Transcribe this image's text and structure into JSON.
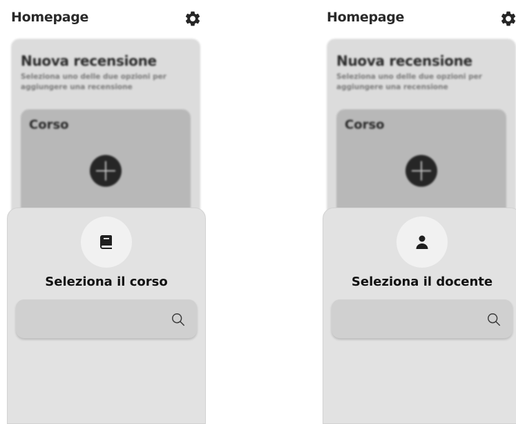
{
  "screens": [
    {
      "header": {
        "title": "Homepage",
        "settings_icon": "gear-icon"
      },
      "background_card": {
        "title": "Nuova recensione",
        "subtitle": "Seleziona uno delle due opzioni per aggiungere una recensione",
        "option_label": "Corso",
        "add_icon": "plus-circle-icon"
      },
      "sheet": {
        "icon": "book-icon",
        "title": "Seleziona il corso",
        "search": {
          "value": "",
          "icon": "search-icon"
        }
      }
    },
    {
      "header": {
        "title": "Homepage",
        "settings_icon": "gear-icon"
      },
      "background_card": {
        "title": "Nuova recensione",
        "subtitle": "Seleziona uno delle due opzioni per aggiungere una recensione",
        "option_label": "Corso",
        "add_icon": "plus-circle-icon"
      },
      "sheet": {
        "icon": "person-icon",
        "title": "Seleziona il docente",
        "search": {
          "value": "",
          "icon": "search-icon"
        }
      }
    }
  ],
  "colors": {
    "sheet_background": "#e2e2e2",
    "search_field": "#d0d0d0",
    "card_background": "#dcdcdc",
    "option_box": "#b8b8b8",
    "icon_dark": "#262626"
  }
}
